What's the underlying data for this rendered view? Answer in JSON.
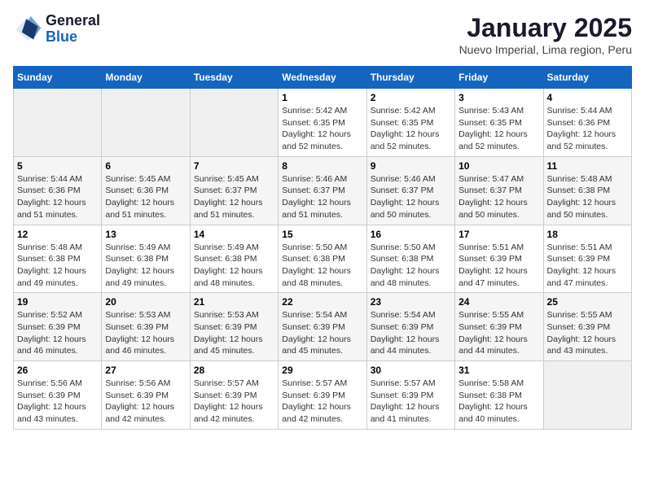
{
  "header": {
    "logo_line1": "General",
    "logo_line2": "Blue",
    "month": "January 2025",
    "location": "Nuevo Imperial, Lima region, Peru"
  },
  "days_of_week": [
    "Sunday",
    "Monday",
    "Tuesday",
    "Wednesday",
    "Thursday",
    "Friday",
    "Saturday"
  ],
  "weeks": [
    [
      {
        "day": "",
        "info": ""
      },
      {
        "day": "",
        "info": ""
      },
      {
        "day": "",
        "info": ""
      },
      {
        "day": "1",
        "info": "Sunrise: 5:42 AM\nSunset: 6:35 PM\nDaylight: 12 hours\nand 52 minutes."
      },
      {
        "day": "2",
        "info": "Sunrise: 5:42 AM\nSunset: 6:35 PM\nDaylight: 12 hours\nand 52 minutes."
      },
      {
        "day": "3",
        "info": "Sunrise: 5:43 AM\nSunset: 6:35 PM\nDaylight: 12 hours\nand 52 minutes."
      },
      {
        "day": "4",
        "info": "Sunrise: 5:44 AM\nSunset: 6:36 PM\nDaylight: 12 hours\nand 52 minutes."
      }
    ],
    [
      {
        "day": "5",
        "info": "Sunrise: 5:44 AM\nSunset: 6:36 PM\nDaylight: 12 hours\nand 51 minutes."
      },
      {
        "day": "6",
        "info": "Sunrise: 5:45 AM\nSunset: 6:36 PM\nDaylight: 12 hours\nand 51 minutes."
      },
      {
        "day": "7",
        "info": "Sunrise: 5:45 AM\nSunset: 6:37 PM\nDaylight: 12 hours\nand 51 minutes."
      },
      {
        "day": "8",
        "info": "Sunrise: 5:46 AM\nSunset: 6:37 PM\nDaylight: 12 hours\nand 51 minutes."
      },
      {
        "day": "9",
        "info": "Sunrise: 5:46 AM\nSunset: 6:37 PM\nDaylight: 12 hours\nand 50 minutes."
      },
      {
        "day": "10",
        "info": "Sunrise: 5:47 AM\nSunset: 6:37 PM\nDaylight: 12 hours\nand 50 minutes."
      },
      {
        "day": "11",
        "info": "Sunrise: 5:48 AM\nSunset: 6:38 PM\nDaylight: 12 hours\nand 50 minutes."
      }
    ],
    [
      {
        "day": "12",
        "info": "Sunrise: 5:48 AM\nSunset: 6:38 PM\nDaylight: 12 hours\nand 49 minutes."
      },
      {
        "day": "13",
        "info": "Sunrise: 5:49 AM\nSunset: 6:38 PM\nDaylight: 12 hours\nand 49 minutes."
      },
      {
        "day": "14",
        "info": "Sunrise: 5:49 AM\nSunset: 6:38 PM\nDaylight: 12 hours\nand 48 minutes."
      },
      {
        "day": "15",
        "info": "Sunrise: 5:50 AM\nSunset: 6:38 PM\nDaylight: 12 hours\nand 48 minutes."
      },
      {
        "day": "16",
        "info": "Sunrise: 5:50 AM\nSunset: 6:38 PM\nDaylight: 12 hours\nand 48 minutes."
      },
      {
        "day": "17",
        "info": "Sunrise: 5:51 AM\nSunset: 6:39 PM\nDaylight: 12 hours\nand 47 minutes."
      },
      {
        "day": "18",
        "info": "Sunrise: 5:51 AM\nSunset: 6:39 PM\nDaylight: 12 hours\nand 47 minutes."
      }
    ],
    [
      {
        "day": "19",
        "info": "Sunrise: 5:52 AM\nSunset: 6:39 PM\nDaylight: 12 hours\nand 46 minutes."
      },
      {
        "day": "20",
        "info": "Sunrise: 5:53 AM\nSunset: 6:39 PM\nDaylight: 12 hours\nand 46 minutes."
      },
      {
        "day": "21",
        "info": "Sunrise: 5:53 AM\nSunset: 6:39 PM\nDaylight: 12 hours\nand 45 minutes."
      },
      {
        "day": "22",
        "info": "Sunrise: 5:54 AM\nSunset: 6:39 PM\nDaylight: 12 hours\nand 45 minutes."
      },
      {
        "day": "23",
        "info": "Sunrise: 5:54 AM\nSunset: 6:39 PM\nDaylight: 12 hours\nand 44 minutes."
      },
      {
        "day": "24",
        "info": "Sunrise: 5:55 AM\nSunset: 6:39 PM\nDaylight: 12 hours\nand 44 minutes."
      },
      {
        "day": "25",
        "info": "Sunrise: 5:55 AM\nSunset: 6:39 PM\nDaylight: 12 hours\nand 43 minutes."
      }
    ],
    [
      {
        "day": "26",
        "info": "Sunrise: 5:56 AM\nSunset: 6:39 PM\nDaylight: 12 hours\nand 43 minutes."
      },
      {
        "day": "27",
        "info": "Sunrise: 5:56 AM\nSunset: 6:39 PM\nDaylight: 12 hours\nand 42 minutes."
      },
      {
        "day": "28",
        "info": "Sunrise: 5:57 AM\nSunset: 6:39 PM\nDaylight: 12 hours\nand 42 minutes."
      },
      {
        "day": "29",
        "info": "Sunrise: 5:57 AM\nSunset: 6:39 PM\nDaylight: 12 hours\nand 42 minutes."
      },
      {
        "day": "30",
        "info": "Sunrise: 5:57 AM\nSunset: 6:39 PM\nDaylight: 12 hours\nand 41 minutes."
      },
      {
        "day": "31",
        "info": "Sunrise: 5:58 AM\nSunset: 6:38 PM\nDaylight: 12 hours\nand 40 minutes."
      },
      {
        "day": "",
        "info": ""
      }
    ]
  ]
}
